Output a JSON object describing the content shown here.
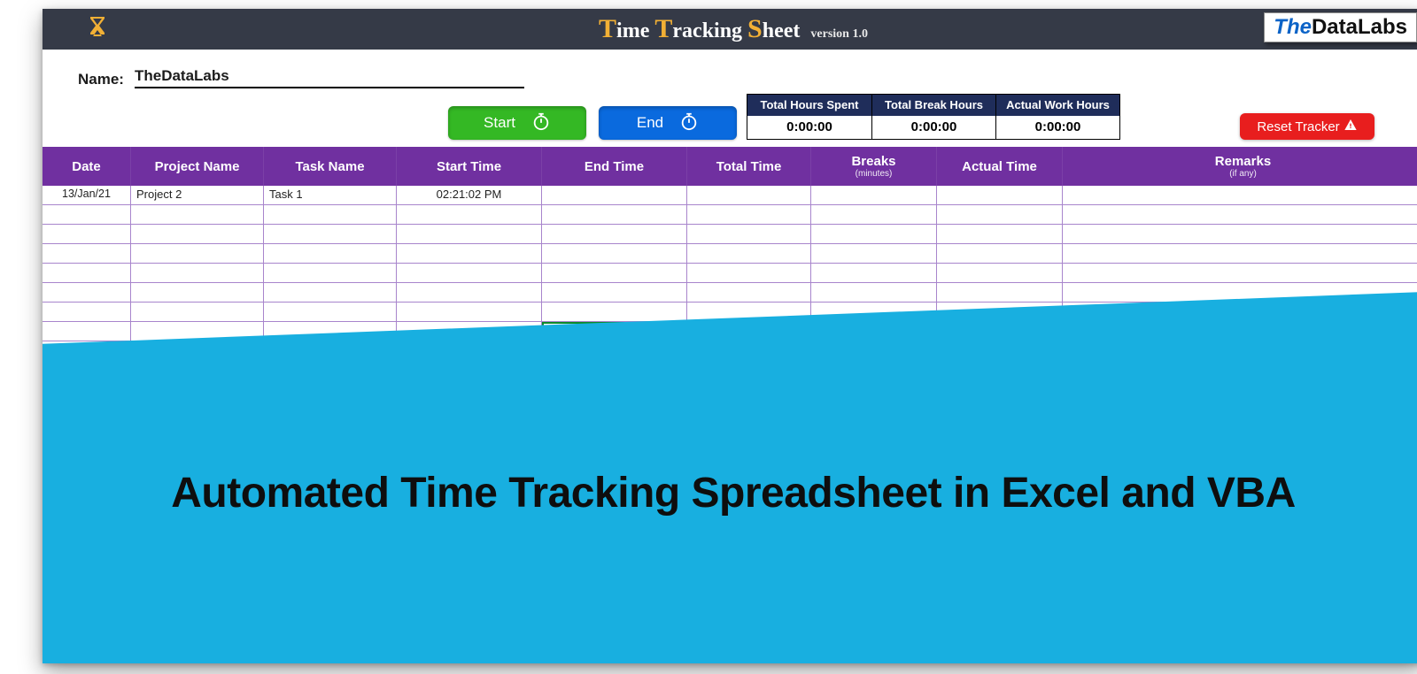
{
  "header": {
    "title_parts": {
      "t": "T",
      "ime": "ime ",
      "t2": "T",
      "racking": "racking ",
      "s": "S",
      "heet": "heet",
      "version": "version 1.0"
    },
    "logo_the": "The",
    "logo_datalabs": "DataLabs"
  },
  "name": {
    "label": "Name:",
    "value": "TheDataLabs"
  },
  "buttons": {
    "start": "Start",
    "end": "End",
    "reset": "Reset Tracker"
  },
  "summary": {
    "cols": [
      {
        "head": "Total Hours Spent",
        "val": "0:00:00"
      },
      {
        "head": "Total Break Hours",
        "val": "0:00:00"
      },
      {
        "head": "Actual Work Hours",
        "val": "0:00:00"
      }
    ]
  },
  "grid": {
    "headers": {
      "date": "Date",
      "project": "Project Name",
      "task": "Task Name",
      "start": "Start Time",
      "end": "End Time",
      "total": "Total Time",
      "breaks": "Breaks",
      "breaks_sub": "(minutes)",
      "actual": "Actual Time",
      "remarks": "Remarks",
      "remarks_sub": "(if any)"
    },
    "rows": [
      {
        "date": "13/Jan/21",
        "project": "Project 2",
        "task": "Task 1",
        "start": "02:21:02 PM",
        "end": "",
        "total": "",
        "breaks": "",
        "actual": "",
        "remarks": ""
      },
      {
        "date": "",
        "project": "",
        "task": "",
        "start": "",
        "end": "",
        "total": "",
        "breaks": "",
        "actual": "",
        "remarks": ""
      },
      {
        "date": "",
        "project": "",
        "task": "",
        "start": "",
        "end": "",
        "total": "",
        "breaks": "",
        "actual": "",
        "remarks": ""
      },
      {
        "date": "",
        "project": "",
        "task": "",
        "start": "",
        "end": "",
        "total": "",
        "breaks": "",
        "actual": "",
        "remarks": ""
      },
      {
        "date": "",
        "project": "",
        "task": "",
        "start": "",
        "end": "",
        "total": "",
        "breaks": "",
        "actual": "",
        "remarks": ""
      },
      {
        "date": "",
        "project": "",
        "task": "",
        "start": "",
        "end": "",
        "total": "",
        "breaks": "",
        "actual": "",
        "remarks": ""
      },
      {
        "date": "",
        "project": "",
        "task": "",
        "start": "",
        "end": "",
        "total": "",
        "breaks": "",
        "actual": "",
        "remarks": ""
      },
      {
        "date": "",
        "project": "",
        "task": "",
        "start": "",
        "end": "",
        "total": "",
        "breaks": "",
        "actual": "",
        "remarks": ""
      }
    ]
  },
  "overlay": {
    "headline": "Automated Time Tracking Spreadsheet in Excel and VBA"
  }
}
